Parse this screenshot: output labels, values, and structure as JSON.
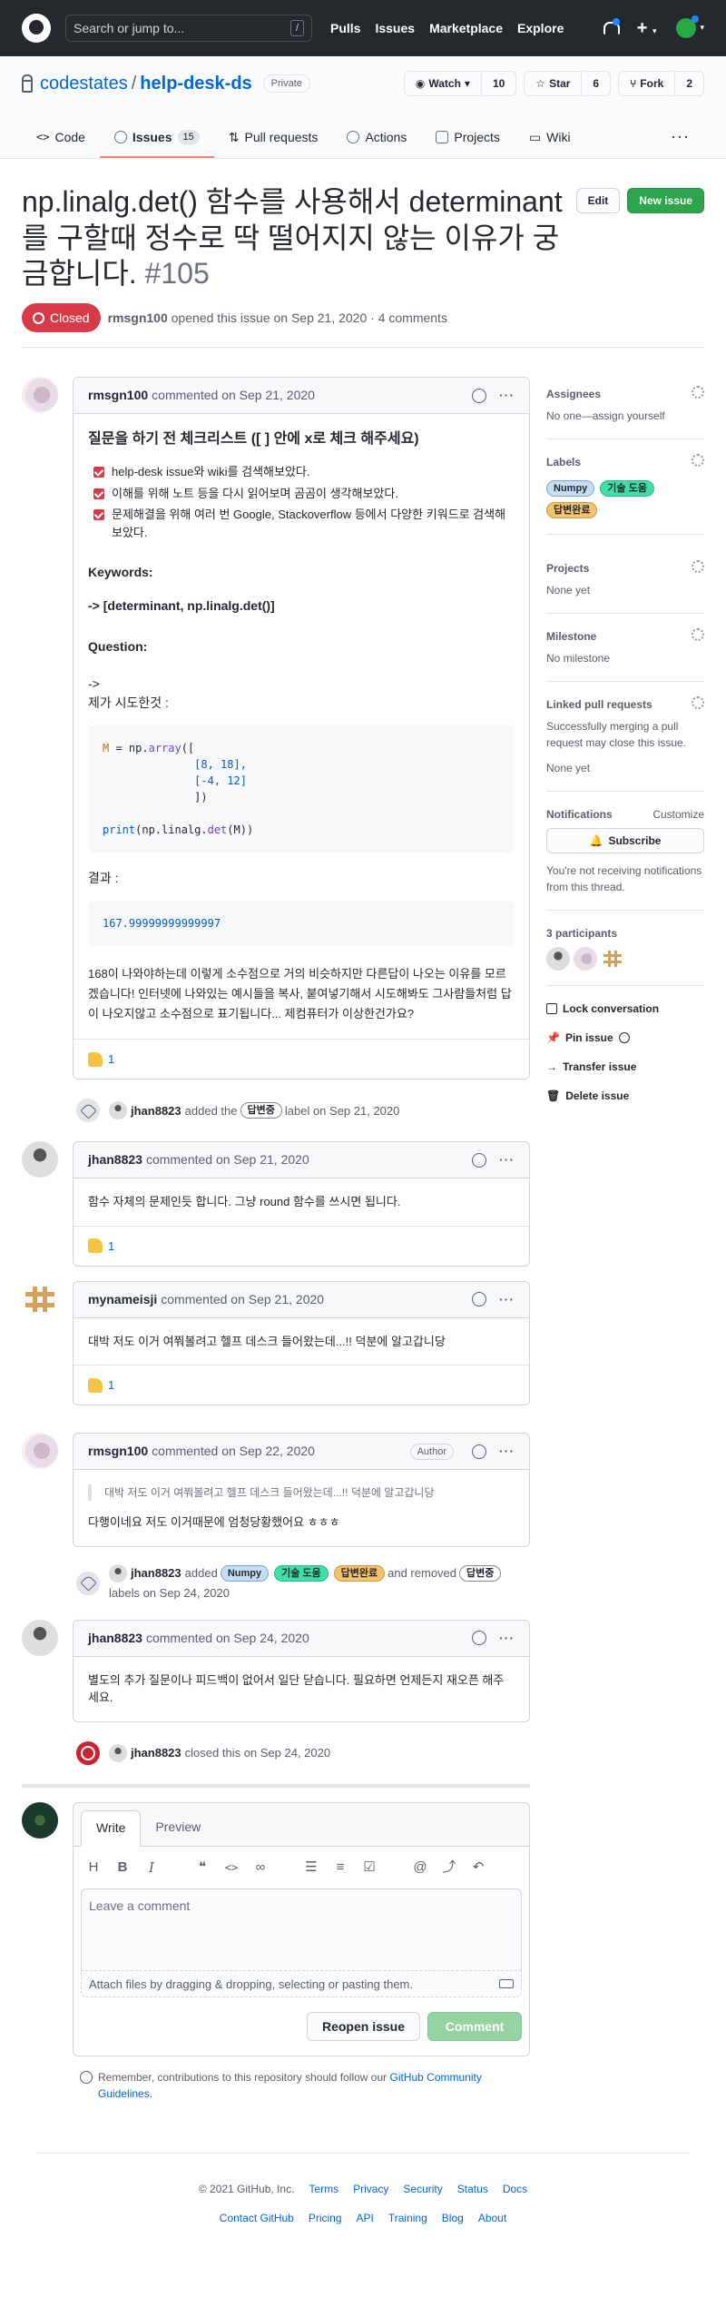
{
  "header": {
    "search_placeholder": "Search or jump to...",
    "slash": "/",
    "nav": [
      "Pulls",
      "Issues",
      "Marketplace",
      "Explore"
    ]
  },
  "repo": {
    "owner": "codestates",
    "sep": "/",
    "name": "help-desk-ds",
    "visibility": "Private",
    "watch": {
      "label": "Watch",
      "count": "10"
    },
    "star": {
      "label": "Star",
      "count": "6"
    },
    "fork": {
      "label": "Fork",
      "count": "2"
    }
  },
  "tabs": [
    {
      "label": "Code"
    },
    {
      "label": "Issues",
      "count": "15"
    },
    {
      "label": "Pull requests"
    },
    {
      "label": "Actions"
    },
    {
      "label": "Projects"
    },
    {
      "label": "Wiki"
    }
  ],
  "issue": {
    "title": "np.linalg.det() 함수를 사용해서 determinant를 구할때 정수로 딱 떨어지지 않는 이유가 궁금합니다.",
    "number": "#105",
    "edit": "Edit",
    "new_issue": "New issue",
    "status": "Closed",
    "author": "rmsgn100",
    "opened_text": "opened this issue on Sep 21, 2020 · 4 comments"
  },
  "comments": [
    {
      "author": "rmsgn100",
      "when": "commented on Sep 21, 2020",
      "heading": "질문을 하기 전 체크리스트 ([ ] 안에 x로 체크 해주세요)",
      "checklist": [
        "help-desk issue와 wiki를 검색해보았다.",
        "이해를 위해 노트 등을 다시 읽어보며 곰곰이 생각해보았다.",
        "문제해결을 위해 여러 번 Google, Stackoverflow 등에서 다양한 키워드로 검색해 보았다."
      ],
      "keywords_label": "Keywords:",
      "keywords": "-> [determinant, np.linalg.det()]",
      "question_label": "Question:",
      "arrow": "->",
      "tried": "제가 시도한것 :",
      "code1_a": "M",
      "code1_b": " = np.",
      "code1_c": "array",
      "code1_d": "([",
      "code1_l2": "              [8, 18],",
      "code1_l3": "              [-4, 12]",
      "code1_l4": "              ])",
      "code1_p1": "print",
      "code1_p2": "(np.linalg.",
      "code1_p3": "det",
      "code1_p4": "(M))",
      "result_label": "결과 :",
      "result": "167.99999999999997",
      "body_end": "168이 나와야하는데 이렇게 소수점으로 거의 비슷하지만 다른답이 나오는 이유를 모르겠습니다! 인터넷에 나와있는 예시들을 복사, 붙여넣기해서 시도해봐도 그사람들처럼 답이 나오지않고 소수점으로 표기됩니다... 제컴퓨터가 이상한건가요?",
      "reaction": "1"
    },
    {
      "author": "jhan8823",
      "when": "commented on Sep 21, 2020",
      "body": "함수 자체의 문제인듯 합니다. 그냥 round 함수를 쓰시면 됩니다.",
      "reaction": "1"
    },
    {
      "author": "mynameisji",
      "when": "commented on Sep 21, 2020",
      "body": "대박 저도 이거 여쭤볼려고 헬프 데스크 들어왔는데...!! 덕분에 알고갑니당",
      "reaction": "1"
    },
    {
      "author": "rmsgn100",
      "when": "commented on Sep 22, 2020",
      "badge": "Author",
      "quote": "대박 저도 이거 여쭤볼려고 헬프 데스크 들어왔는데...!! 덕분에 알고갑니당",
      "body": "다행이네요 저도 이거때문에 엄청당황했어요 ㅎㅎㅎ"
    },
    {
      "author": "jhan8823",
      "when": "commented on Sep 24, 2020",
      "body": "별도의 추가 질문이나 피드백이 없어서 일단 닫습니다. 필요하면 언제든지 재오픈 해주세요."
    }
  ],
  "events": {
    "e1": {
      "actor": "jhan8823",
      "text1": "added the",
      "label": "답변중",
      "text2": "label on Sep 21, 2020"
    },
    "e2": {
      "actor": "jhan8823",
      "text1": "added",
      "labels": [
        "Numpy",
        "기술 도움",
        "답변완료"
      ],
      "text2": "and removed",
      "removed": "답변중",
      "text3": "labels on Sep 24, 2020"
    },
    "e3": {
      "actor": "jhan8823",
      "text": "closed this on Sep 24, 2020"
    }
  },
  "composer": {
    "write": "Write",
    "preview": "Preview",
    "placeholder": "Leave a comment",
    "attach": "Attach files by dragging & dropping, selecting or pasting them.",
    "reopen": "Reopen issue",
    "comment": "Comment",
    "remind_a": "Remember, contributions to this repository should follow our ",
    "remind_link": "GitHub Community Guidelines",
    "remind_b": "."
  },
  "sidebar": {
    "assignees": "Assignees",
    "assignees_val": "No one—assign yourself",
    "labels": "Labels",
    "label_list": [
      "Numpy",
      "기술 도움",
      "답변완료"
    ],
    "projects": "Projects",
    "projects_val": "None yet",
    "milestone": "Milestone",
    "milestone_val": "No milestone",
    "linked": "Linked pull requests",
    "linked_val": "Successfully merging a pull request may close this issue.",
    "linked_none": "None yet",
    "notifications": "Notifications",
    "customize": "Customize",
    "subscribe": "Subscribe",
    "notif_val": "You're not receiving notifications from this thread.",
    "participants": "3 participants",
    "lock": "Lock conversation",
    "pin": "Pin issue",
    "transfer": "Transfer issue",
    "delete": "Delete issue"
  },
  "footer": {
    "row1": [
      "© 2021 GitHub, Inc.",
      "Terms",
      "Privacy",
      "Security",
      "Status",
      "Docs"
    ],
    "row2": [
      "Contact GitHub",
      "Pricing",
      "API",
      "Training",
      "Blog",
      "About"
    ]
  }
}
